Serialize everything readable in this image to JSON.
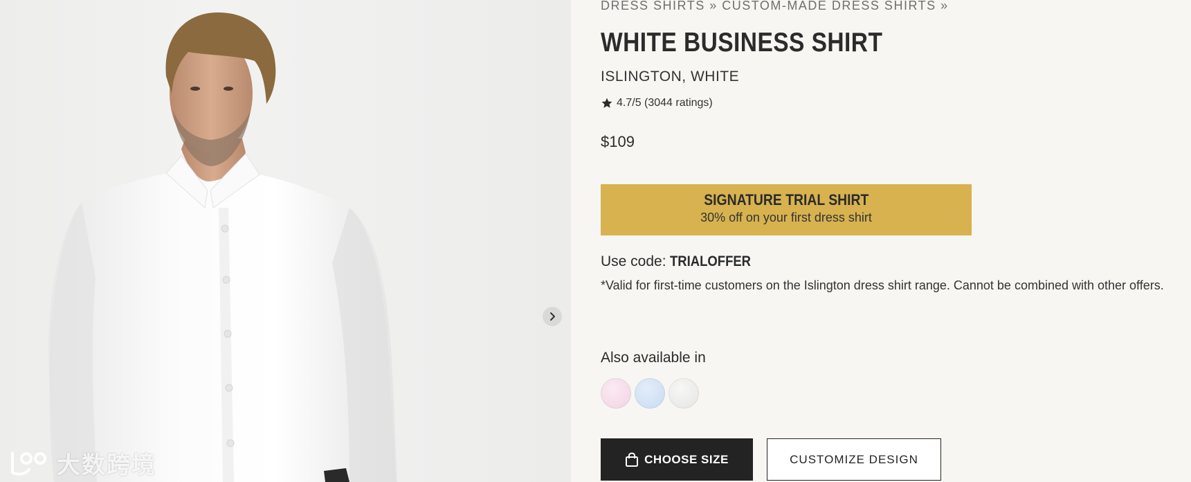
{
  "breadcrumb": {
    "items": [
      "DRESS SHIRTS",
      "CUSTOM-MADE DRESS SHIRTS"
    ],
    "separator": "»"
  },
  "product": {
    "title": "WHITE BUSINESS SHIRT",
    "subtitle": "ISLINGTON, WHITE",
    "rating_text": "4.7/5 (3044 ratings)",
    "price": "$109"
  },
  "promo": {
    "title": "SIGNATURE TRIAL SHIRT",
    "subtitle": "30% off on your first dress shirt",
    "background_color": "#d7b24f"
  },
  "code": {
    "label": "Use code:",
    "value": "TRIALOFFER",
    "disclaimer": "*Valid for first-time customers on the Islington dress shirt range. Cannot be combined with other offers."
  },
  "variants": {
    "label": "Also available in",
    "swatches": [
      {
        "name": "pink",
        "color": "#f3dbe8"
      },
      {
        "name": "light-blue",
        "color": "#cfdff4"
      },
      {
        "name": "white",
        "color": "#ebebea"
      }
    ]
  },
  "actions": {
    "choose_size": "CHOOSE SIZE",
    "customize": "CUSTOMIZE DESIGN"
  },
  "gallery": {
    "next_icon": "chevron-right-icon"
  },
  "watermark": {
    "text": "大数跨境"
  }
}
